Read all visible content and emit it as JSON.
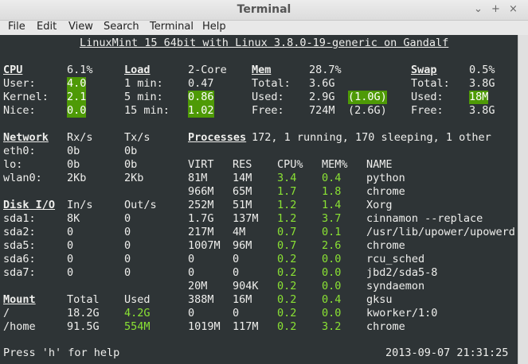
{
  "window": {
    "title": "Terminal",
    "controls": [
      "⌄",
      "+",
      "×"
    ]
  },
  "menu": [
    "File",
    "Edit",
    "View",
    "Search",
    "Terminal",
    "Help"
  ],
  "header": "LinuxMint 15 64bit with Linux 3.8.0-19-generic on Gandalf",
  "cpu": {
    "label": "CPU",
    "total": "6.1%",
    "user_label": "User:",
    "user": "4.0",
    "kernel_label": "Kernel:",
    "kernel": "2.1",
    "nice_label": "Nice:",
    "nice": "0.0"
  },
  "load": {
    "label": "Load",
    "cores": "2-Core",
    "m1_label": "1 min:",
    "m1": "0.47",
    "m5_label": "5 min:",
    "m5": "0.86",
    "m15_label": "15 min:",
    "m15": "1.02"
  },
  "mem": {
    "label": "Mem",
    "percent": "28.7%",
    "total_label": "Total:",
    "total": "3.6G",
    "used_label": "Used:",
    "used": "2.9G",
    "used_extra": "(1.0G)",
    "free_label": "Free:",
    "free": "724M",
    "free_extra": "(2.6G)"
  },
  "swap": {
    "label": "Swap",
    "percent": "0.5%",
    "total_label": "Total:",
    "total": "3.8G",
    "used_label": "Used:",
    "used": "18M",
    "free_label": "Free:",
    "free": "3.8G"
  },
  "network": {
    "label": "Network",
    "rx": "Rx/s",
    "tx": "Tx/s",
    "rows": [
      [
        "eth0:",
        "0b",
        "0b"
      ],
      [
        "lo:",
        "0b",
        "0b"
      ],
      [
        "wlan0:",
        "2Kb",
        "2Kb"
      ]
    ]
  },
  "disk": {
    "label": "Disk I/O",
    "in": "In/s",
    "out": "Out/s",
    "rows": [
      [
        "sda1:",
        "8K",
        "0"
      ],
      [
        "sda2:",
        "0",
        "0"
      ],
      [
        "sda5:",
        "0",
        "0"
      ],
      [
        "sda6:",
        "0",
        "0"
      ],
      [
        "sda7:",
        "0",
        "0"
      ]
    ]
  },
  "mount": {
    "label": "Mount",
    "total": "Total",
    "used": "Used",
    "rows": [
      [
        "/",
        "18.2G",
        "4.2G"
      ],
      [
        "/home",
        "91.5G",
        "554M"
      ]
    ]
  },
  "processes": {
    "label": "Processes",
    "summary": "172, 1 running, 170 sleeping, 1 other",
    "headers": [
      "VIRT",
      "RES",
      "CPU%",
      "MEM%",
      "NAME"
    ],
    "rows": [
      [
        "81M",
        "14M",
        "3.4",
        "0.4",
        "python"
      ],
      [
        "966M",
        "65M",
        "1.7",
        "1.8",
        "chrome"
      ],
      [
        "252M",
        "51M",
        "1.2",
        "1.4",
        "Xorg"
      ],
      [
        "1.7G",
        "137M",
        "1.2",
        "3.7",
        "cinnamon --replace"
      ],
      [
        "217M",
        "4M",
        "0.7",
        "0.1",
        "/usr/lib/upower/upowerd"
      ],
      [
        "1007M",
        "96M",
        "0.7",
        "2.6",
        "chrome"
      ],
      [
        "0",
        "0",
        "0.2",
        "0.0",
        "rcu_sched"
      ],
      [
        "0",
        "0",
        "0.2",
        "0.0",
        "jbd2/sda5-8"
      ],
      [
        "20M",
        "904K",
        "0.2",
        "0.0",
        "syndaemon"
      ],
      [
        "388M",
        "16M",
        "0.2",
        "0.4",
        "gksu"
      ],
      [
        "0",
        "0",
        "0.2",
        "0.0",
        "kworker/1:0"
      ],
      [
        "1019M",
        "117M",
        "0.2",
        "3.2",
        "chrome"
      ]
    ]
  },
  "footer": {
    "help": "Press 'h' for help",
    "datetime": "2013-09-07 21:31:25"
  }
}
